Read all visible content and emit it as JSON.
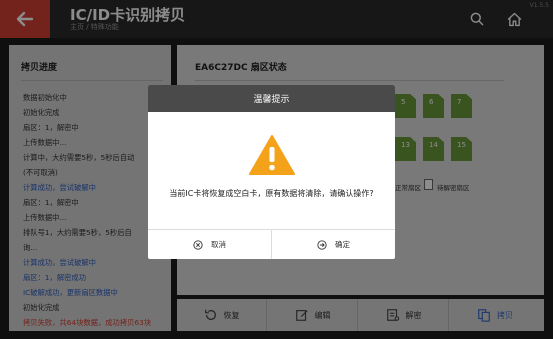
{
  "header": {
    "title": "IC/ID卡识别拷贝",
    "breadcrumb": "主页 / 特殊功能",
    "version": "V1.5.5"
  },
  "left_panel": {
    "title": "拷贝进度",
    "log": [
      {
        "text": "数据初始化中",
        "style": "normal"
      },
      {
        "text": "初始化完成",
        "style": "normal"
      },
      {
        "text": "扇区：1，解密中",
        "style": "normal"
      },
      {
        "text": "上传数据中...",
        "style": "normal"
      },
      {
        "text": "计算中，大约需要5秒，5秒后自动",
        "style": "normal"
      },
      {
        "text": "(不可取消)",
        "style": "normal"
      },
      {
        "text": "计算成功，尝试破解中",
        "style": "blue"
      },
      {
        "text": "扇区：1，解密中",
        "style": "normal"
      },
      {
        "text": "上传数据中...",
        "style": "normal"
      },
      {
        "text": "排队号1，大约需要5秒，5秒后自",
        "style": "normal"
      },
      {
        "text": "询...",
        "style": "normal"
      },
      {
        "text": "计算成功，尝试破解中",
        "style": "blue"
      },
      {
        "text": "扇区：1，解密成功",
        "style": "blue"
      },
      {
        "text": "IC破解成功，更新扇区数据中",
        "style": "blue"
      },
      {
        "text": "初始化完成",
        "style": "normal"
      },
      {
        "text": "拷贝失败，共64块数据，成功拷贝63块",
        "style": "red"
      }
    ]
  },
  "right_panel": {
    "title": "EA6C27DC 扇区状态",
    "sectors_row1": [
      "5",
      "6",
      "7"
    ],
    "sectors_row2": [
      "13",
      "14",
      "15"
    ],
    "legend_normal": "正常扇区",
    "legend_pending": "待解密扇区",
    "sector_color": "#6b9a3a"
  },
  "toolbar": {
    "buttons": [
      {
        "label": "恢复",
        "icon": "restore-icon"
      },
      {
        "label": "编辑",
        "icon": "edit-icon"
      },
      {
        "label": "解密",
        "icon": "decrypt-icon"
      },
      {
        "label": "拷贝",
        "icon": "copy-icon"
      }
    ]
  },
  "dialog": {
    "title": "温馨提示",
    "message": "当前IC卡将恢复成空白卡，原有数据将清除，请确认操作?",
    "cancel_label": "取消",
    "confirm_label": "确定",
    "warning_color": "#f5a21b"
  },
  "colors": {
    "accent": "#d43e33",
    "header_bg": "#2a2a2a",
    "link_blue": "#2f5fbf",
    "active_blue": "#3a63c8"
  }
}
